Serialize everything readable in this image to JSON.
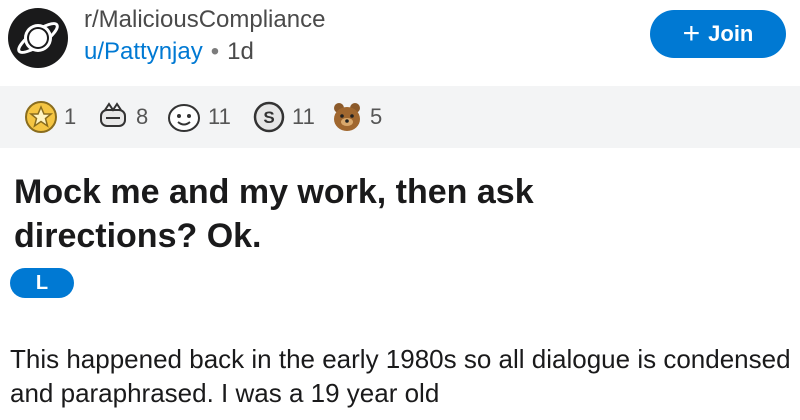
{
  "post": {
    "subreddit": "r/MaliciousCompliance",
    "username": "u/Pattynjay",
    "separator": "•",
    "age": "1d",
    "join_label": "Join",
    "join_icon": "+",
    "awards": [
      {
        "icon": "gold-award-icon",
        "count": "1"
      },
      {
        "icon": "helpful-award-icon",
        "count": "8"
      },
      {
        "icon": "wholesome-award-icon",
        "count": "11"
      },
      {
        "icon": "silver-coin-award-icon",
        "count": "11"
      },
      {
        "icon": "bear-award-icon",
        "count": "5"
      }
    ],
    "title": "Mock me and my work, then ask directions? Ok.",
    "flair": "L",
    "body": "This happened back in the early 1980s so all dialogue is condensed and paraphrased.  I was a 19 year old"
  },
  "colors": {
    "accent": "#0079d3",
    "award_bar": "#f3f4f5"
  }
}
